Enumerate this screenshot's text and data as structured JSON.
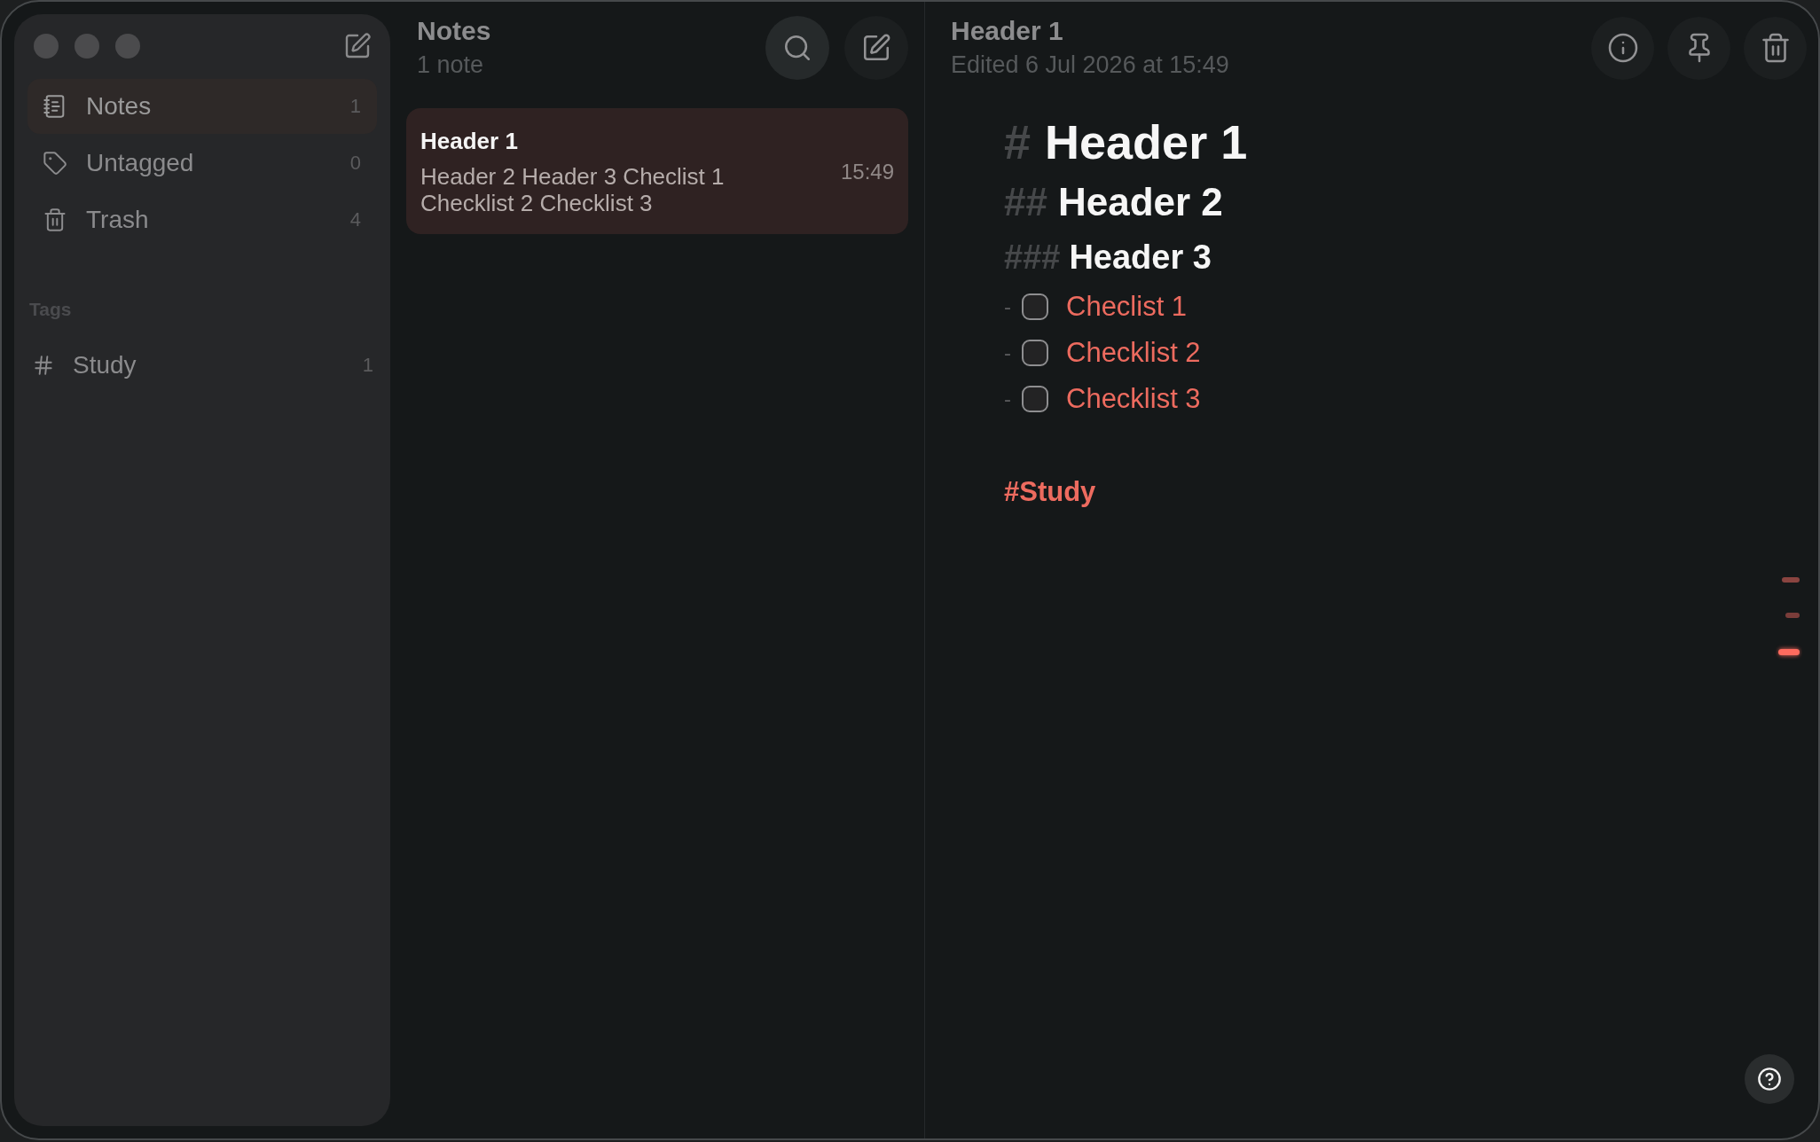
{
  "sidebar": {
    "items": [
      {
        "kind": "notes",
        "label": "Notes",
        "count": "1",
        "selected": true
      },
      {
        "kind": "untagged",
        "label": "Untagged",
        "count": "0",
        "selected": false
      },
      {
        "kind": "trash",
        "label": "Trash",
        "count": "4",
        "selected": false
      }
    ],
    "tags_heading": "Tags",
    "tags": [
      {
        "label": "Study",
        "count": "1",
        "selected": false
      }
    ]
  },
  "note_list": {
    "title": "Notes",
    "subtitle": "1 note",
    "notes": [
      {
        "title": "Header 1",
        "preview": "Header 2 Header 3 Checlist 1 Checklist 2 Checklist 3",
        "time": "15:49",
        "selected": true
      }
    ]
  },
  "editor": {
    "title": "Header 1",
    "edited": "Edited 6 Jul 2026 at 15:49",
    "blocks": [
      {
        "kind": "heading1",
        "marker": "#",
        "text": "Header 1"
      },
      {
        "kind": "heading2",
        "marker": "##",
        "text": "Header 2"
      },
      {
        "kind": "heading3",
        "marker": "###",
        "text": "Header 3"
      },
      {
        "kind": "checklist",
        "marker": "-",
        "text": "Checlist 1",
        "checked": false
      },
      {
        "kind": "checklist",
        "marker": "-",
        "text": "Checklist 2",
        "checked": false
      },
      {
        "kind": "checklist",
        "marker": "-",
        "text": "Checklist 3",
        "checked": false
      },
      {
        "kind": "tag",
        "text": "#Study"
      }
    ]
  }
}
